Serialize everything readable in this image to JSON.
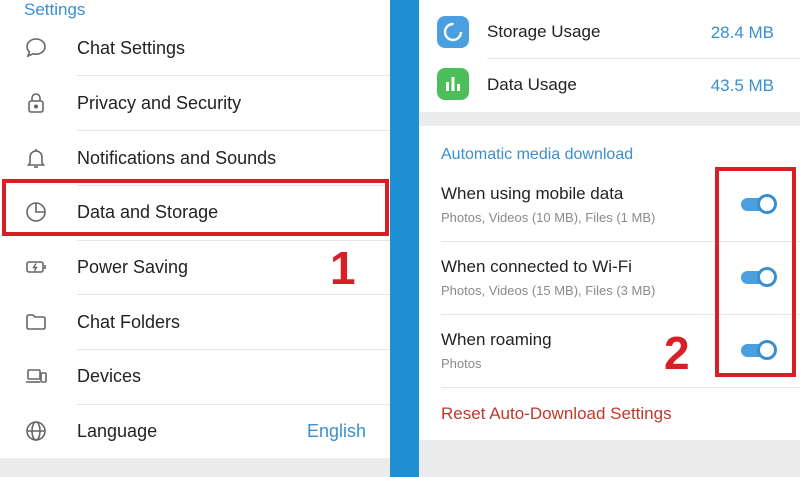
{
  "left": {
    "section_title": "Settings",
    "items": [
      {
        "label": "Chat Settings",
        "icon": "chat-bubble-icon"
      },
      {
        "label": "Privacy and Security",
        "icon": "lock-icon"
      },
      {
        "label": "Notifications and Sounds",
        "icon": "bell-icon"
      },
      {
        "label": "Data and Storage",
        "icon": "pie-chart-icon"
      },
      {
        "label": "Power Saving",
        "icon": "battery-icon"
      },
      {
        "label": "Chat Folders",
        "icon": "folder-icon"
      },
      {
        "label": "Devices",
        "icon": "devices-icon"
      },
      {
        "label": "Language",
        "icon": "globe-icon",
        "value": "English"
      }
    ]
  },
  "annotations": {
    "step1": "1",
    "step2": "2",
    "highlight_color": "#d91f26"
  },
  "right": {
    "usage": [
      {
        "label": "Storage Usage",
        "value": "28.4 MB",
        "icon": "storage-icon",
        "color": "#4a9fe0"
      },
      {
        "label": "Data Usage",
        "value": "43.5 MB",
        "icon": "bar-chart-icon",
        "color": "#4cbf5a"
      }
    ],
    "auto_title": "Automatic media download",
    "auto_rows": [
      {
        "title": "When using mobile data",
        "subtitle": "Photos, Videos (10 MB), Files (1 MB)",
        "enabled": true
      },
      {
        "title": "When connected to Wi-Fi",
        "subtitle": "Photos, Videos (15 MB), Files (3 MB)",
        "enabled": true
      },
      {
        "title": "When roaming",
        "subtitle": "Photos",
        "enabled": true
      }
    ],
    "reset_label": "Reset Auto-Download Settings"
  },
  "colors": {
    "accent": "#3a8fd0",
    "divider_stripe": "#1f8fd3",
    "reset": "#c0392b"
  }
}
